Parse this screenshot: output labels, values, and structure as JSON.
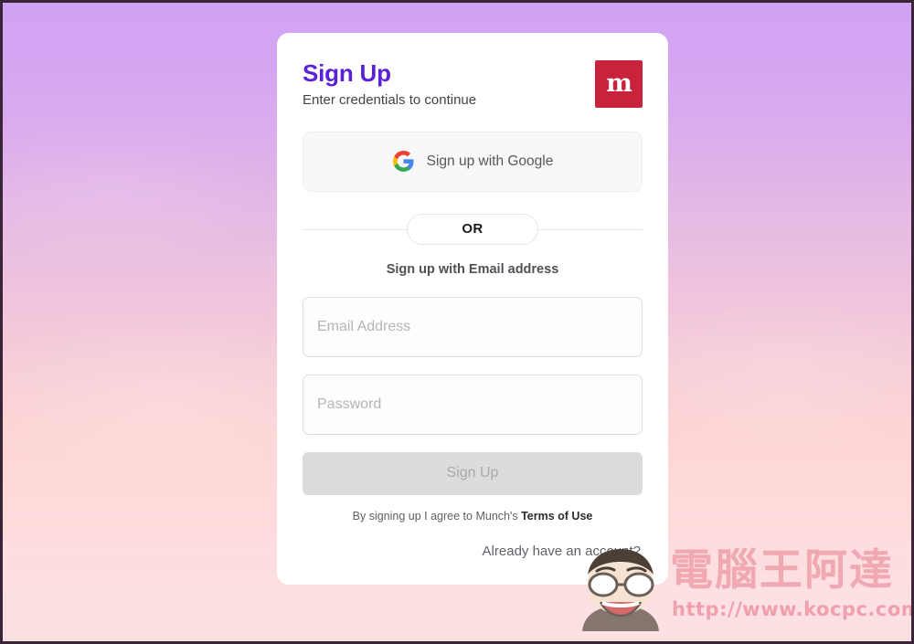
{
  "background": {
    "gradient_top": "#d0a2f2",
    "gradient_mid": "#eebede",
    "gradient_bottom": "#fce1e3"
  },
  "card": {
    "header": {
      "title": "Sign Up",
      "subtitle": "Enter credentials to continue",
      "logo_letter": "m",
      "logo_color": "#c8223c",
      "title_color": "#5b21d6"
    },
    "social": {
      "google_label": "Sign up with Google",
      "google_icon": "google-g-icon"
    },
    "divider": {
      "or_label": "OR"
    },
    "email_section_label": "Sign up with Email address",
    "fields": [
      {
        "name": "email",
        "placeholder": "Email Address",
        "value": ""
      },
      {
        "name": "password",
        "placeholder": "Password",
        "value": ""
      }
    ],
    "submit": {
      "label": "Sign Up",
      "disabled": true
    },
    "terms": {
      "prefix": "By signing up I agree to Munch's ",
      "link": "Terms of Use"
    },
    "footer": {
      "already_account": "Already have an account?"
    }
  },
  "watermark": {
    "brand": "電腦王阿達",
    "url": "http://www.kocpc.com.tw",
    "color": "#f0a8b2"
  }
}
